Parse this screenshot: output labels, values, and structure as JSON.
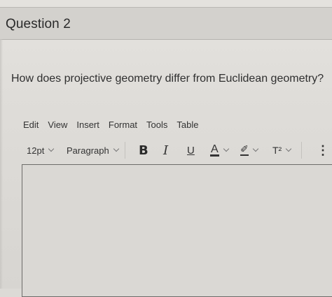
{
  "question": {
    "title": "Question 2",
    "text": "How does projective geometry differ from Euclidean geometry?"
  },
  "editor": {
    "menu": [
      "Edit",
      "View",
      "Insert",
      "Format",
      "Tools",
      "Table"
    ],
    "toolbar": {
      "font_size": "12pt",
      "block_format": "Paragraph",
      "bold": "B",
      "italic": "I",
      "underline": "U",
      "text_color": "A",
      "highlight": "✐",
      "superscript": "T²",
      "more": "⋮"
    },
    "content": ""
  }
}
